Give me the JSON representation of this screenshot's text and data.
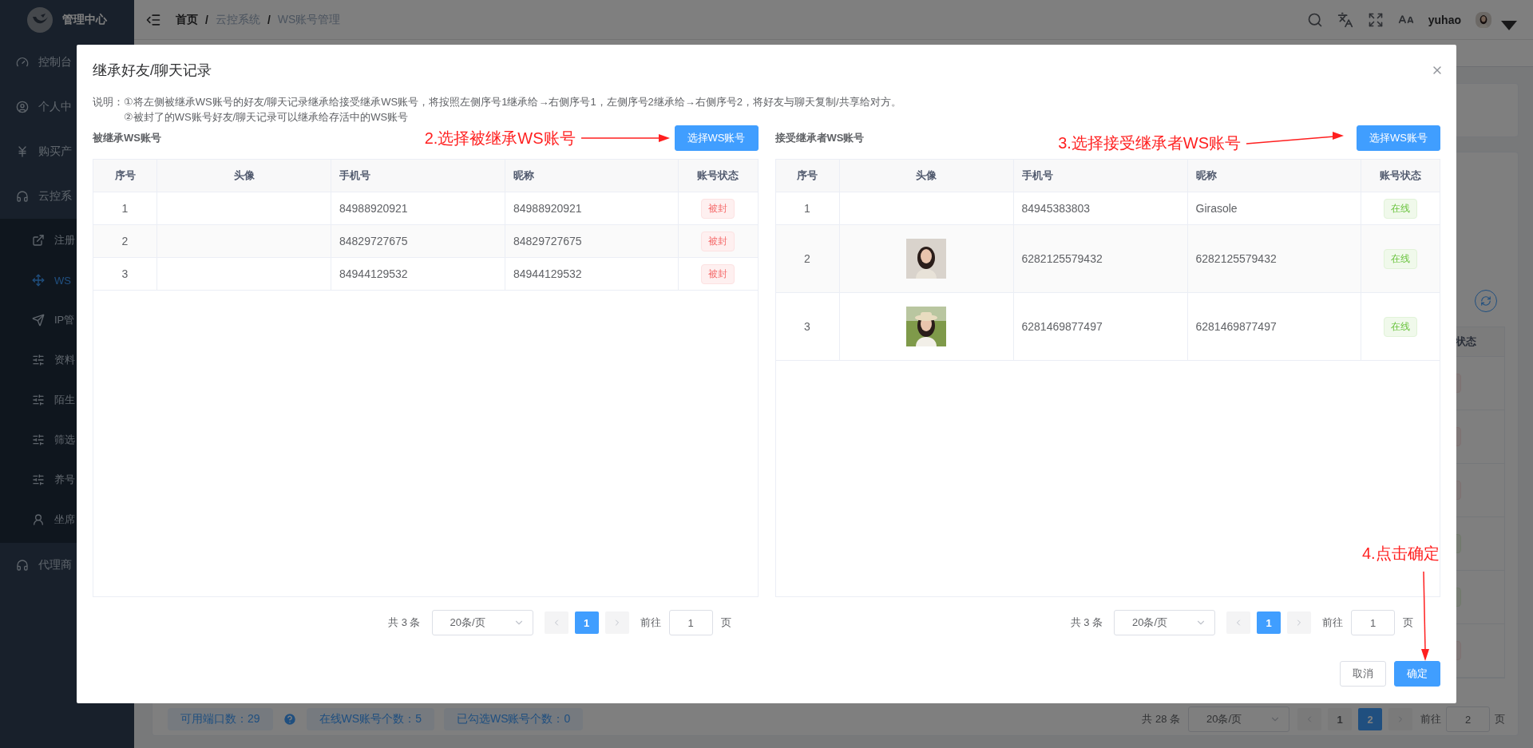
{
  "sidebar": {
    "logo": "管理中心",
    "items": [
      {
        "label": "控制台",
        "selected": false
      },
      {
        "label": "个人中",
        "selected": false
      },
      {
        "label": "购买产",
        "selected": false
      },
      {
        "label": "云控系",
        "selected": false,
        "expanded": true,
        "children": [
          {
            "label": "注册",
            "selected": false
          },
          {
            "label": "WS",
            "selected": true
          },
          {
            "label": "IP管",
            "selected": false
          },
          {
            "label": "资料",
            "selected": false
          },
          {
            "label": "陌生",
            "selected": false
          },
          {
            "label": "筛选",
            "selected": false
          },
          {
            "label": "养号",
            "selected": false
          },
          {
            "label": "坐席",
            "selected": false
          }
        ]
      },
      {
        "label": "代理商",
        "selected": false
      }
    ]
  },
  "header": {
    "breadcrumb": [
      "首页",
      "云控系统",
      "WS账号管理"
    ],
    "breadcrumb_separator": "/",
    "user": "yuhao"
  },
  "background": {
    "table": {
      "column": "状态",
      "rows": [
        {
          "kind": "danger"
        },
        {
          "kind": "danger"
        },
        {
          "kind": "danger"
        },
        {
          "kind": "success"
        },
        {
          "kind": "success"
        },
        {
          "kind": "danger"
        }
      ]
    },
    "stats": [
      "可用端口数：29",
      "在线WS账号个数：5",
      "已勾选WS账号个数：0"
    ],
    "pagination": {
      "total": "共 28 条",
      "page_size": "20条/页",
      "pages": [
        {
          "label": "1",
          "selected": false
        },
        {
          "label": "2",
          "selected": true
        }
      ],
      "goto_label": "前往",
      "goto_value": "2",
      "page_suffix": "页"
    }
  },
  "dialog": {
    "title": "继承好友/聊天记录",
    "note_label": "说明：",
    "note_lines": [
      "①将左侧被继承WS账号的好友/聊天记录继承给接受继承WS账号，将按照左侧序号1继承给→右侧序号1，左侧序号2继承给→右侧序号2，将好友与聊天复制/共享给对方。",
      "②被封了的WS账号好友/聊天记录可以继承给存活中的WS账号"
    ],
    "panels": [
      {
        "title": "被继承WS账号",
        "annotation": "2.选择被继承WS账号",
        "button": "选择WS账号",
        "columns": [
          "序号",
          "头像",
          "手机号",
          "昵称",
          "账号状态"
        ],
        "rows": [
          {
            "index": "1",
            "avatar": false,
            "phone": "84988920921",
            "nickname": "84988920921",
            "status": {
              "text": "被封",
              "kind": "danger"
            }
          },
          {
            "index": "2",
            "avatar": false,
            "phone": "84829727675",
            "nickname": "84829727675",
            "status": {
              "text": "被封",
              "kind": "danger"
            }
          },
          {
            "index": "3",
            "avatar": false,
            "phone": "84944129532",
            "nickname": "84944129532",
            "status": {
              "text": "被封",
              "kind": "danger"
            }
          }
        ],
        "pagination": {
          "total": "共 3 条",
          "page_size": "20条/页",
          "pages": [
            {
              "label": "1",
              "selected": true
            }
          ],
          "goto_label": "前往",
          "goto_value": "1",
          "page_suffix": "页"
        }
      },
      {
        "title": "接受继承者WS账号",
        "annotation": "3.选择接受继承者WS账号",
        "button": "选择WS账号",
        "columns": [
          "序号",
          "头像",
          "手机号",
          "昵称",
          "账号状态"
        ],
        "rows": [
          {
            "index": "1",
            "avatar": false,
            "phone": "84945383803",
            "nickname": "Girasole",
            "status": {
              "text": "在线",
              "kind": "success"
            }
          },
          {
            "index": "2",
            "avatar": true,
            "phone": "6282125579432",
            "nickname": "6282125579432",
            "status": {
              "text": "在线",
              "kind": "success"
            }
          },
          {
            "index": "3",
            "avatar": true,
            "phone": "6281469877497",
            "nickname": "6281469877497",
            "status": {
              "text": "在线",
              "kind": "success"
            }
          }
        ],
        "pagination": {
          "total": "共 3 条",
          "page_size": "20条/页",
          "pages": [
            {
              "label": "1",
              "selected": true
            }
          ],
          "goto_label": "前往",
          "goto_value": "1",
          "page_suffix": "页"
        }
      }
    ],
    "annotation": "4.点击确定",
    "buttons": [
      {
        "label": "取消",
        "kind": "default"
      },
      {
        "label": "确定",
        "kind": "primary"
      }
    ]
  }
}
